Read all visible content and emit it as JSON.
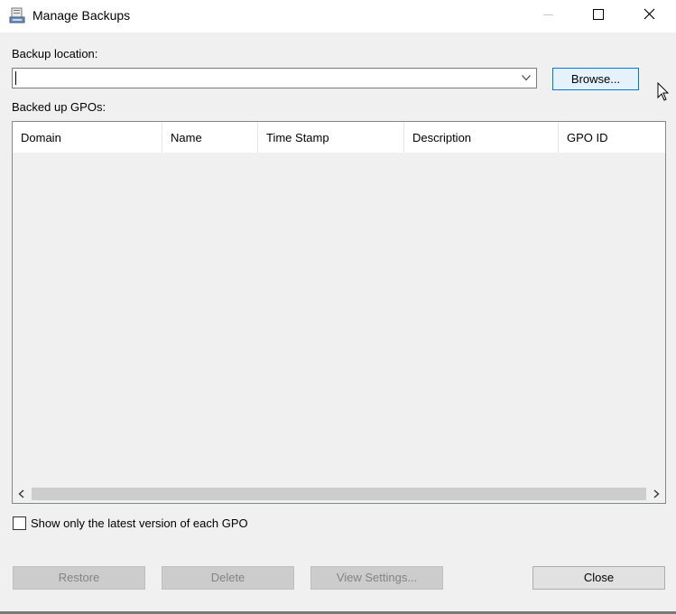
{
  "window": {
    "title": "Manage Backups"
  },
  "backup_location": {
    "label": "Backup location:",
    "value": "",
    "browse_label": "Browse..."
  },
  "backups_list": {
    "label": "Backed up GPOs:",
    "columns": [
      "Domain",
      "Name",
      "Time Stamp",
      "Description",
      "GPO ID"
    ],
    "rows": []
  },
  "options": {
    "latest_only_label": "Show only the latest version of each GPO",
    "latest_only_checked": false
  },
  "buttons": {
    "restore": "Restore",
    "delete": "Delete",
    "view_settings": "View Settings...",
    "close": "Close"
  }
}
